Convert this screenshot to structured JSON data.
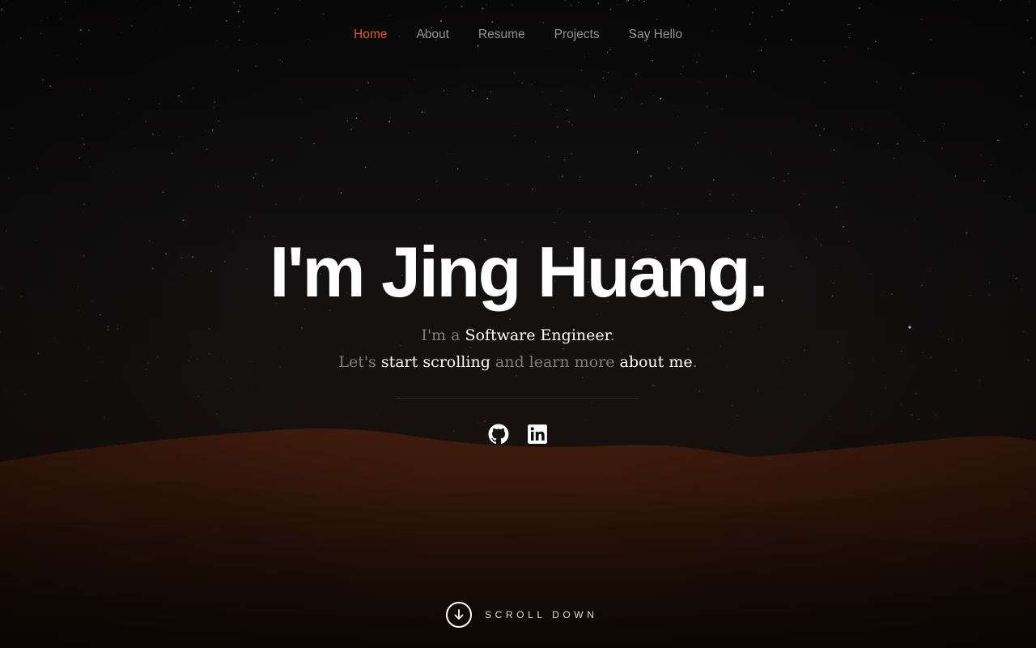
{
  "nav": {
    "items": [
      {
        "label": "Home",
        "active": true
      },
      {
        "label": "About",
        "active": false
      },
      {
        "label": "Resume",
        "active": false
      },
      {
        "label": "Projects",
        "active": false
      },
      {
        "label": "Say Hello",
        "active": false
      }
    ]
  },
  "hero": {
    "title": "I'm Jing Huang.",
    "line1": {
      "p1": "I'm a ",
      "p2": "Software Engineer",
      "p3": "."
    },
    "line2": {
      "p1": "Let's ",
      "p2": "start scrolling",
      "p3": " and learn more ",
      "p4": "about me",
      "p5": "."
    }
  },
  "social": {
    "icons": [
      "github-icon",
      "linkedin-icon"
    ]
  },
  "scroll": {
    "label": "SCROLL DOWN",
    "icon": "arrow-down-icon"
  },
  "colors": {
    "accent": "#e05a2b",
    "text": "#ffffff",
    "muted_text": "rgba(255,255,255,0.45)",
    "background": "#0d0b0a",
    "dunes": "#3a1a0d"
  }
}
